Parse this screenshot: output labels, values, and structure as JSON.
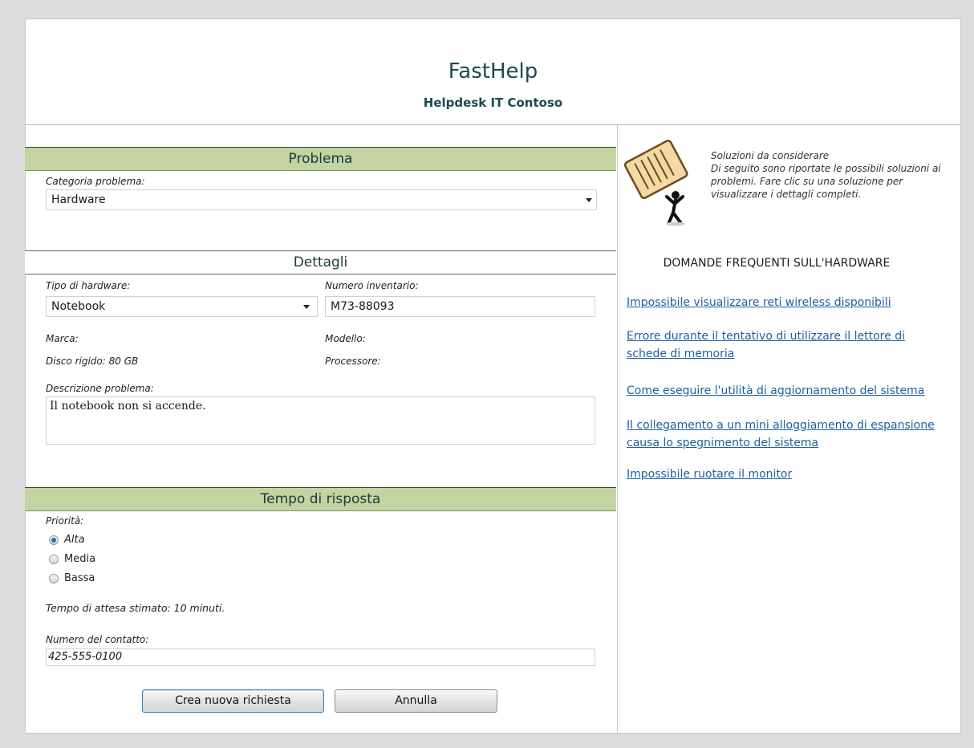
{
  "header": {
    "title": "FastHelp",
    "subtitle": "Helpdesk IT Contoso"
  },
  "problem": {
    "section_title": "Problema",
    "category_label": "Categoria problema:",
    "category_value": "Hardware"
  },
  "details": {
    "section_title": "Dettagli",
    "hardware_type_label": "Tipo di hardware:",
    "hardware_type_value": "Notebook",
    "inventory_label": "Numero inventario:",
    "inventory_value": "M73-88093",
    "brand_label": "Marca:",
    "model_label": "Modello:",
    "disk_label": "Disco rigido: 80 GB",
    "processor_label": "Processore:",
    "description_label": "Descrizione problema:",
    "description_value": "Il notebook non si accende."
  },
  "response": {
    "section_title": "Tempo di risposta",
    "priority_label": "Priorità:",
    "priorities": [
      "Alta",
      "Media",
      "Bassa"
    ],
    "selected_priority": "Alta",
    "wait_text": "Tempo di attesa stimato: 10 minuti.",
    "contact_label": "Numero del contatto:",
    "contact_value": "425-555-0100"
  },
  "buttons": {
    "create": "Crea nuova richiesta",
    "cancel": "Annulla"
  },
  "sidebar": {
    "tips_title": "Soluzioni da considerare",
    "tips_body": "Di seguito sono riportate le possibili soluzioni ai problemi. Fare clic su una soluzione per visualizzare i dettagli completi.",
    "faq_title": "DOMANDE FREQUENTI SULL'HARDWARE",
    "faq_links": [
      "Impossibile visualizzare reti wireless disponibili",
      "Errore durante il tentativo di utilizzare il lettore di schede di memoria",
      "Come eseguire l'utilità di aggiornamento del sistema",
      "Il collegamento a un mini alloggiamento di espansione causa lo spegnimento del sistema",
      "Impossibile ruotare il monitor"
    ]
  },
  "colors": {
    "band_green": "#c3d3a1",
    "title_text": "#1b4a52",
    "link": "#1f5fa0"
  },
  "icons": {
    "tips_illustration": "person-carrying-document-icon"
  }
}
